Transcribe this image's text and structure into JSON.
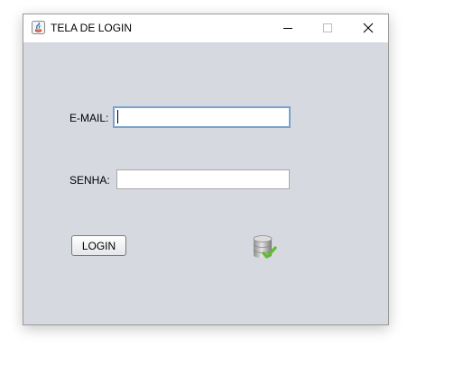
{
  "window": {
    "title": "TELA DE LOGIN",
    "app_icon": "java-icon",
    "controls": [
      "minimize-icon",
      "maximize-icon",
      "close-icon"
    ]
  },
  "form": {
    "email_label": "E-MAIL:",
    "email_value": "",
    "senha_label": "SENHA:",
    "senha_value": "",
    "login_button": "LOGIN"
  },
  "status_icon": "database-check-icon",
  "colors": {
    "window_bg": "#d6d9e0",
    "focus_border": "#7aa2cf",
    "check_green": "#5bbf2a"
  }
}
